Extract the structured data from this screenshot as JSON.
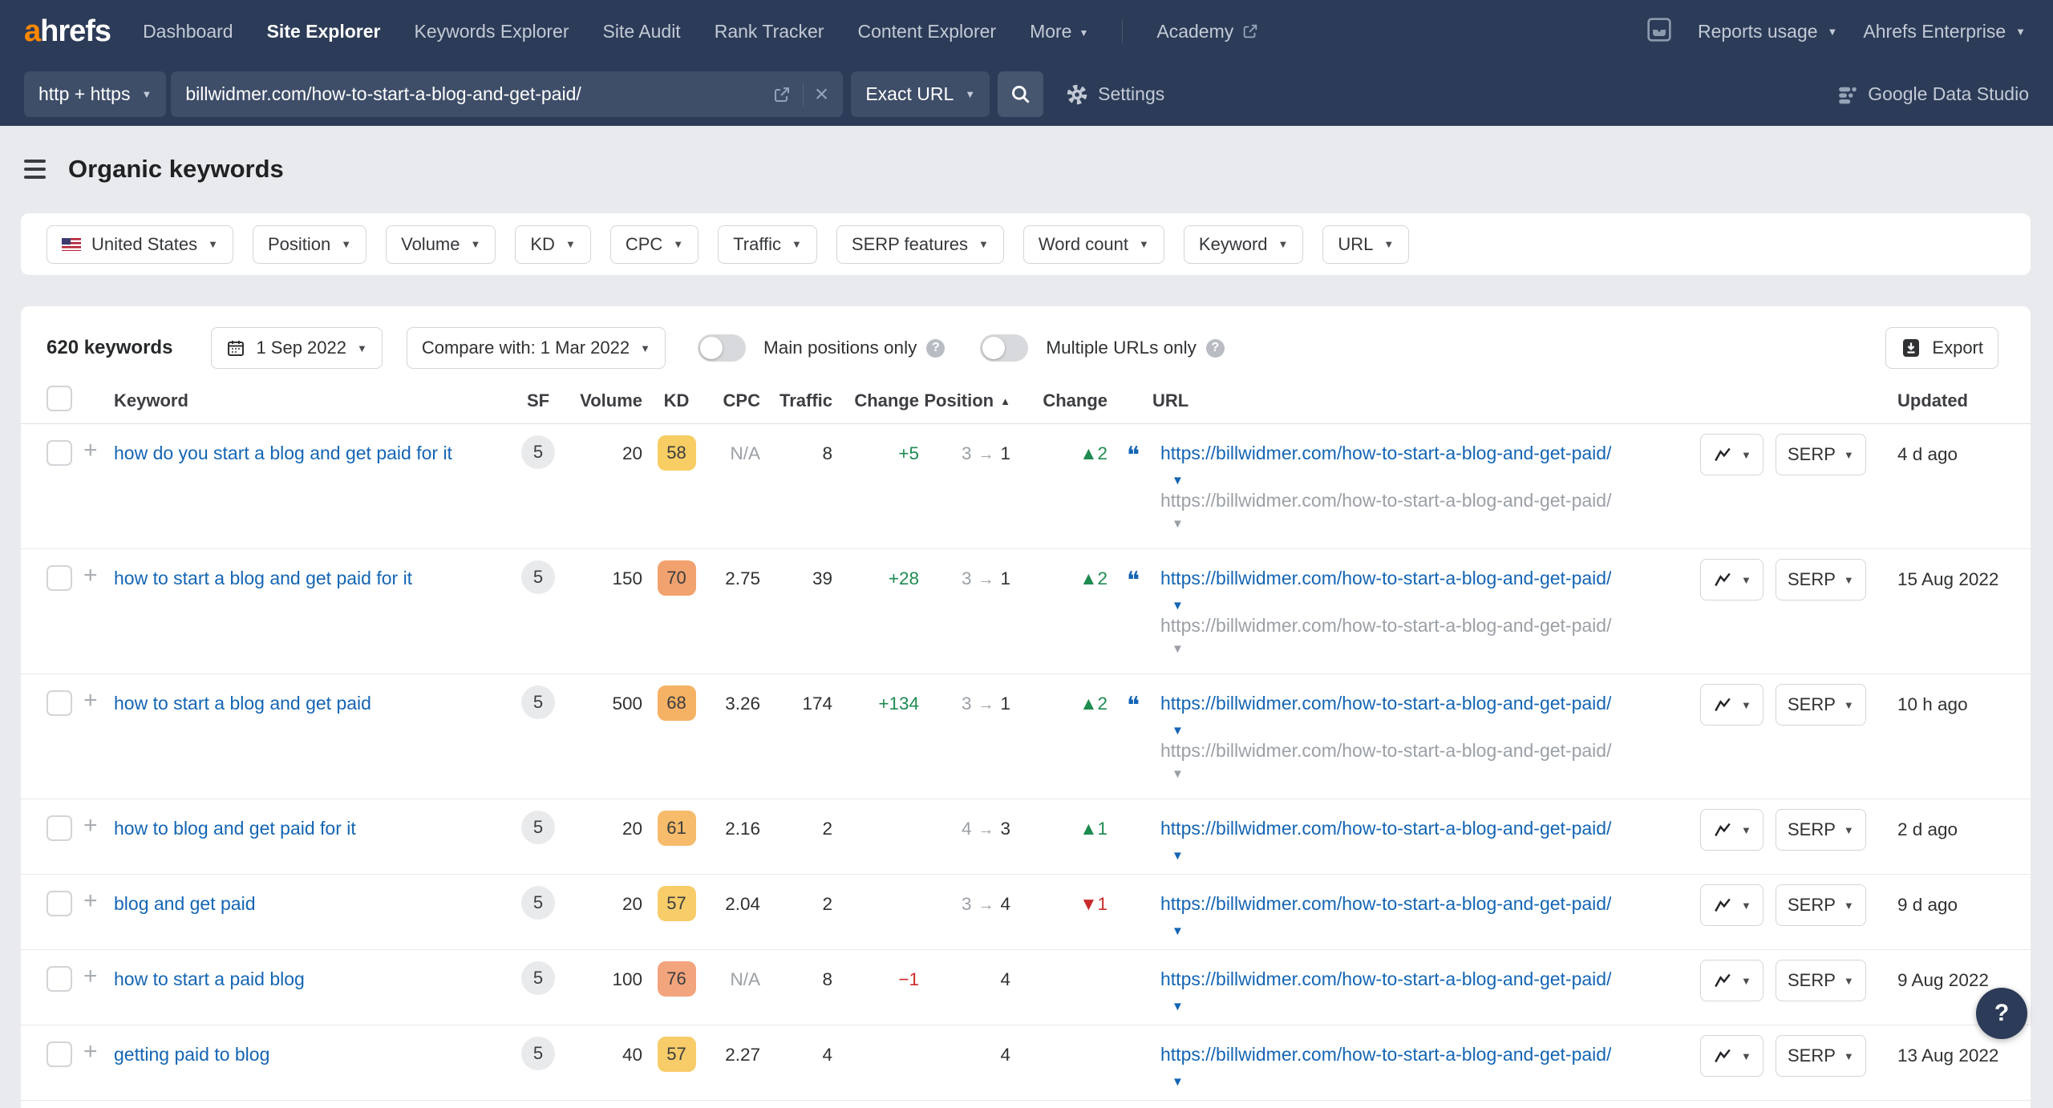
{
  "icons": {
    "caret_down": "▼",
    "arrow_right": "→",
    "triangle_up": "▲",
    "triangle_down": "▼",
    "plus": "+",
    "quote": "❝",
    "close": "×",
    "help": "?"
  },
  "colors": {
    "navy": "#2c3b57",
    "accent_orange": "#ff8800",
    "link_blue": "#1465b4",
    "green": "#1e8b50",
    "red": "#c92a2a"
  },
  "topnav": {
    "logo_a": "a",
    "logo_rest": "hrefs",
    "items": [
      {
        "label": "Dashboard",
        "active": false
      },
      {
        "label": "Site Explorer",
        "active": true
      },
      {
        "label": "Keywords Explorer",
        "active": false
      },
      {
        "label": "Site Audit",
        "active": false
      },
      {
        "label": "Rank Tracker",
        "active": false
      },
      {
        "label": "Content Explorer",
        "active": false
      }
    ],
    "more_label": "More",
    "academy_label": "Academy",
    "reports_usage_label": "Reports usage",
    "account_label": "Ahrefs Enterprise"
  },
  "searchbar": {
    "protocol_value": "http + https",
    "url_value": "billwidmer.com/how-to-start-a-blog-and-get-paid/",
    "mode_value": "Exact URL",
    "settings_label": "Settings",
    "gds_label": "Google Data Studio"
  },
  "page": {
    "title": "Organic keywords"
  },
  "filters": [
    {
      "label": "United States",
      "flag": true
    },
    {
      "label": "Position"
    },
    {
      "label": "Volume"
    },
    {
      "label": "KD"
    },
    {
      "label": "CPC"
    },
    {
      "label": "Traffic"
    },
    {
      "label": "SERP features"
    },
    {
      "label": "Word count"
    },
    {
      "label": "Keyword"
    },
    {
      "label": "URL"
    }
  ],
  "controls": {
    "keywords_count": "620 keywords",
    "date_label": "1 Sep 2022",
    "compare_label": "Compare with: 1 Mar 2022",
    "main_positions_label": "Main positions only",
    "multiple_urls_label": "Multiple URLs only",
    "export_label": "Export"
  },
  "table": {
    "headers": {
      "keyword": "Keyword",
      "sf": "SF",
      "volume": "Volume",
      "kd": "KD",
      "cpc": "CPC",
      "traffic": "Traffic",
      "change": "Change",
      "position": "Position",
      "position_change": "Change",
      "url": "URL",
      "updated": "Updated"
    },
    "serp_label": "SERP",
    "rows": [
      {
        "keyword": "how do you start a blog and get paid for it",
        "sf": "5",
        "volume": "20",
        "kd": "58",
        "kd_color": "#f7cd64",
        "cpc": "N/A",
        "traffic": "8",
        "traffic_change": "+5",
        "pos_old": "3",
        "pos_new": "1",
        "pos_change_dir": "up",
        "pos_change": "2",
        "quoted": true,
        "url": "https://billwidmer.com/how-to-start-a-blog-and-get-paid/",
        "url2": "https://billwidmer.com/how-to-start-a-blog-and-get-paid/",
        "updated": "4 d ago"
      },
      {
        "keyword": "how to start a blog and get paid for it",
        "sf": "5",
        "volume": "150",
        "kd": "70",
        "kd_color": "#f1a26e",
        "cpc": "2.75",
        "traffic": "39",
        "traffic_change": "+28",
        "pos_old": "3",
        "pos_new": "1",
        "pos_change_dir": "up",
        "pos_change": "2",
        "quoted": true,
        "url": "https://billwidmer.com/how-to-start-a-blog-and-get-paid/",
        "url2": "https://billwidmer.com/how-to-start-a-blog-and-get-paid/",
        "updated": "15 Aug 2022"
      },
      {
        "keyword": "how to start a blog and get paid",
        "sf": "5",
        "volume": "500",
        "kd": "68",
        "kd_color": "#f5b164",
        "cpc": "3.26",
        "traffic": "174",
        "traffic_change": "+134",
        "pos_old": "3",
        "pos_new": "1",
        "pos_change_dir": "up",
        "pos_change": "2",
        "quoted": true,
        "url": "https://billwidmer.com/how-to-start-a-blog-and-get-paid/",
        "url2": "https://billwidmer.com/how-to-start-a-blog-and-get-paid/",
        "updated": "10 h ago"
      },
      {
        "keyword": "how to blog and get paid for it",
        "sf": "5",
        "volume": "20",
        "kd": "61",
        "kd_color": "#f6bb6b",
        "cpc": "2.16",
        "traffic": "2",
        "traffic_change": "",
        "pos_old": "4",
        "pos_new": "3",
        "pos_change_dir": "up",
        "pos_change": "1",
        "quoted": false,
        "url": "https://billwidmer.com/how-to-start-a-blog-and-get-paid/",
        "url2": "",
        "updated": "2 d ago"
      },
      {
        "keyword": "blog and get paid",
        "sf": "5",
        "volume": "20",
        "kd": "57",
        "kd_color": "#f7cc69",
        "cpc": "2.04",
        "traffic": "2",
        "traffic_change": "",
        "pos_old": "3",
        "pos_new": "4",
        "pos_change_dir": "down",
        "pos_change": "1",
        "quoted": false,
        "url": "https://billwidmer.com/how-to-start-a-blog-and-get-paid/",
        "url2": "",
        "updated": "9 d ago"
      },
      {
        "keyword": "how to start a paid blog",
        "sf": "5",
        "volume": "100",
        "kd": "76",
        "kd_color": "#f2a47d",
        "cpc": "N/A",
        "traffic": "8",
        "traffic_change": "−1",
        "pos_old": "",
        "pos_new": "4",
        "pos_change_dir": "",
        "pos_change": "",
        "quoted": false,
        "url": "https://billwidmer.com/how-to-start-a-blog-and-get-paid/",
        "url2": "",
        "updated": "9 Aug 2022"
      },
      {
        "keyword": "getting paid to blog",
        "sf": "5",
        "volume": "40",
        "kd": "57",
        "kd_color": "#f7cc69",
        "cpc": "2.27",
        "traffic": "4",
        "traffic_change": "",
        "pos_old": "",
        "pos_new": "4",
        "pos_change_dir": "",
        "pos_change": "",
        "quoted": false,
        "url": "https://billwidmer.com/how-to-start-a-blog-and-get-paid/",
        "url2": "",
        "updated": "13 Aug 2022"
      }
    ]
  },
  "help_fab": "?"
}
